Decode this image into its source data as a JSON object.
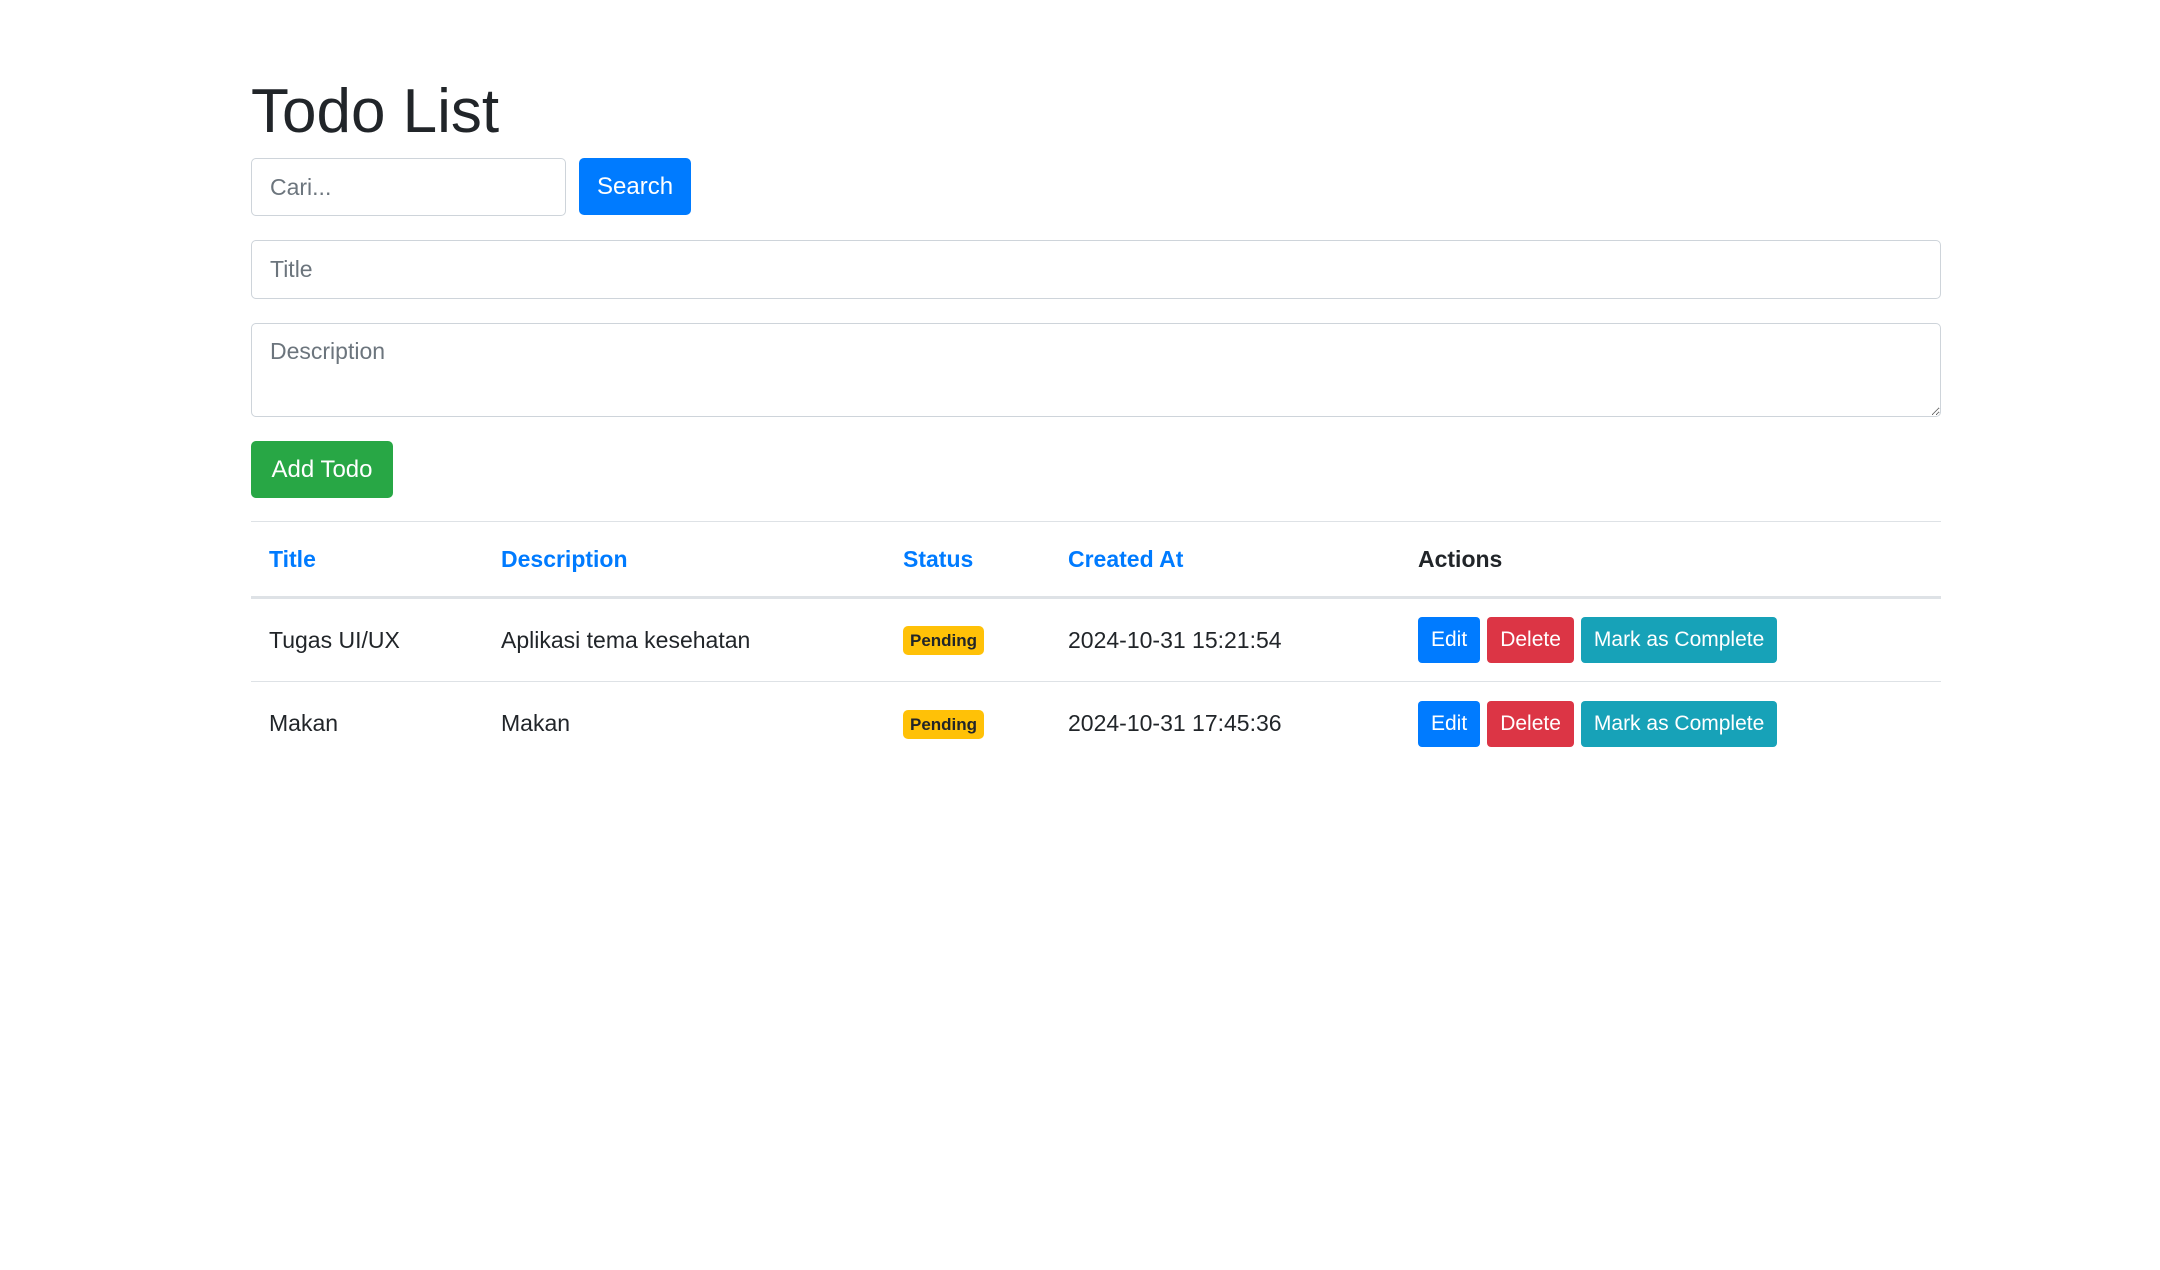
{
  "page": {
    "title": "Todo List"
  },
  "search": {
    "placeholder": "Cari...",
    "button_label": "Search"
  },
  "form": {
    "title_placeholder": "Title",
    "description_placeholder": "Description",
    "add_button_label": "Add Todo"
  },
  "table": {
    "headers": {
      "title": "Title",
      "description": "Description",
      "status": "Status",
      "created_at": "Created At",
      "actions": "Actions"
    },
    "rows": [
      {
        "title": "Tugas UI/UX",
        "description": "Aplikasi tema kesehatan",
        "status": "Pending",
        "created_at": "2024-10-31 15:21:54",
        "edit_label": "Edit",
        "delete_label": "Delete",
        "complete_label": "Mark as Complete"
      },
      {
        "title": "Makan",
        "description": "Makan",
        "status": "Pending",
        "created_at": "2024-10-31 17:45:36",
        "edit_label": "Edit",
        "delete_label": "Delete",
        "complete_label": "Mark as Complete"
      }
    ]
  },
  "colors": {
    "primary": "#007bff",
    "success": "#28a745",
    "danger": "#dc3545",
    "info": "#17a2b8",
    "warning": "#ffc107"
  }
}
